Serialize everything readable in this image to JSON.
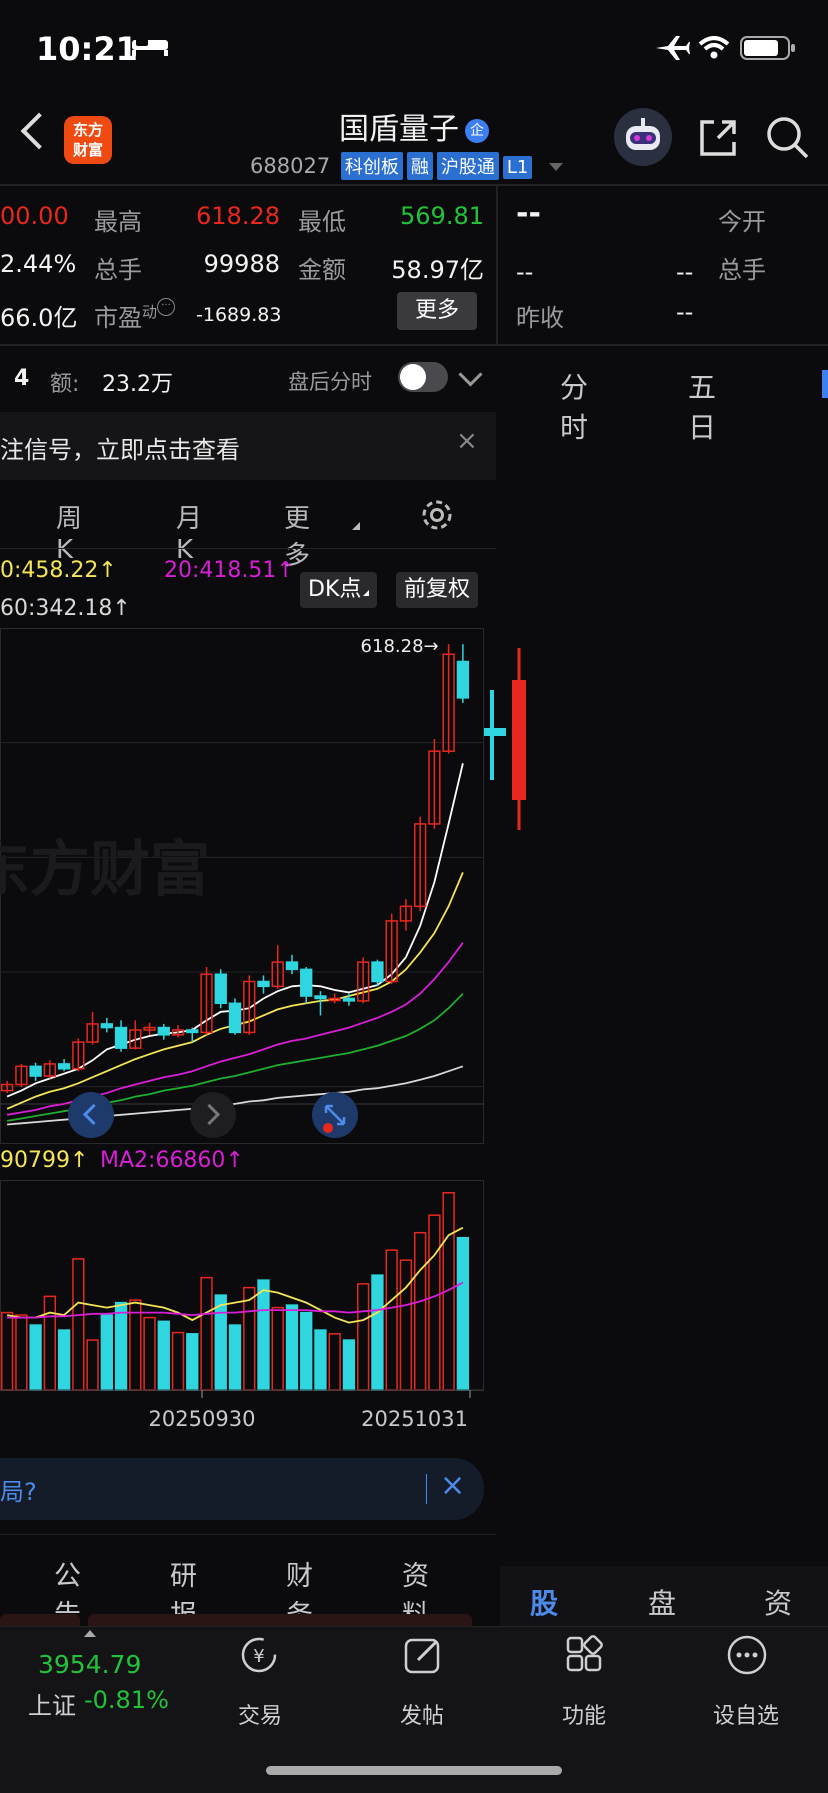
{
  "status_bar": {
    "time": "10:21"
  },
  "header": {
    "logo_text_line1": "东方",
    "logo_text_line2": "财富",
    "stock_name": "国盾量子",
    "name_badge": "企",
    "code": "688027",
    "tags": [
      "科创板",
      "融",
      "沪股通",
      "L1"
    ]
  },
  "quote": {
    "cut_price": "00.00",
    "high_label": "最高",
    "high_value": "618.28",
    "low_label": "最低",
    "low_value": "569.81",
    "cut_pct": "2.44%",
    "volume_label": "总手",
    "volume_value": "99988",
    "amount_label": "金额",
    "amount_value": "58.97亿",
    "cut_cap": "66.0亿",
    "pe_label": "市盈",
    "pe_sup": "动",
    "pe_value": "-1689.83",
    "more_label": "更多"
  },
  "right_quote": {
    "dash_big": "--",
    "open_label": "今开",
    "dash1": "--",
    "dash2": "--",
    "vol_label": "总手",
    "prev_label": "昨收",
    "prev_value": "--"
  },
  "after_hours": {
    "cut_num": "4",
    "amount_label": "额:",
    "amount_value": "23.2万",
    "toggle_label": "盘后分时"
  },
  "right_time_tabs": [
    "分时",
    "五日"
  ],
  "signal_bar": {
    "text": "注信号，立即点击查看"
  },
  "period_tabs": [
    "周K",
    "月K",
    "更多"
  ],
  "ma_legend": {
    "ma10": "0:458.22",
    "ma20": "20:418.51",
    "ma60": "60:342.18"
  },
  "chart_buttons": {
    "dk": "DK点",
    "adjust": "前复权"
  },
  "volume_legend": {
    "ma1": "90799",
    "ma2": "MA2:66860"
  },
  "watermark": "东方财富",
  "chart_data": {
    "type": "candlestick",
    "high_marker": "618.28",
    "x_tick_labels": [
      "20250930",
      "20251031"
    ],
    "candles": [
      {
        "o": 250,
        "c": 255,
        "h": 258,
        "l": 248
      },
      {
        "o": 255,
        "c": 270,
        "h": 272,
        "l": 253
      },
      {
        "o": 270,
        "c": 262,
        "h": 273,
        "l": 258
      },
      {
        "o": 262,
        "c": 272,
        "h": 275,
        "l": 260
      },
      {
        "o": 272,
        "c": 268,
        "h": 276,
        "l": 266
      },
      {
        "o": 268,
        "c": 290,
        "h": 293,
        "l": 266
      },
      {
        "o": 290,
        "c": 305,
        "h": 315,
        "l": 288
      },
      {
        "o": 305,
        "c": 302,
        "h": 310,
        "l": 298
      },
      {
        "o": 302,
        "c": 285,
        "h": 308,
        "l": 282
      },
      {
        "o": 285,
        "c": 300,
        "h": 308,
        "l": 284
      },
      {
        "o": 300,
        "c": 302,
        "h": 306,
        "l": 296
      },
      {
        "o": 302,
        "c": 296,
        "h": 305,
        "l": 292
      },
      {
        "o": 296,
        "c": 300,
        "h": 304,
        "l": 294
      },
      {
        "o": 300,
        "c": 298,
        "h": 302,
        "l": 290
      },
      {
        "o": 298,
        "c": 346,
        "h": 352,
        "l": 296
      },
      {
        "o": 346,
        "c": 322,
        "h": 350,
        "l": 318
      },
      {
        "o": 322,
        "c": 298,
        "h": 326,
        "l": 296
      },
      {
        "o": 298,
        "c": 340,
        "h": 345,
        "l": 296
      },
      {
        "o": 340,
        "c": 336,
        "h": 345,
        "l": 330
      },
      {
        "o": 336,
        "c": 356,
        "h": 370,
        "l": 334
      },
      {
        "o": 356,
        "c": 350,
        "h": 362,
        "l": 346
      },
      {
        "o": 350,
        "c": 328,
        "h": 352,
        "l": 322
      },
      {
        "o": 328,
        "c": 326,
        "h": 332,
        "l": 312
      },
      {
        "o": 326,
        "c": 326,
        "h": 330,
        "l": 322
      },
      {
        "o": 326,
        "c": 324,
        "h": 330,
        "l": 320
      },
      {
        "o": 324,
        "c": 356,
        "h": 360,
        "l": 322
      },
      {
        "o": 356,
        "c": 340,
        "h": 358,
        "l": 336
      },
      {
        "o": 340,
        "c": 390,
        "h": 396,
        "l": 338
      },
      {
        "o": 390,
        "c": 402,
        "h": 408,
        "l": 382
      },
      {
        "o": 402,
        "c": 470,
        "h": 476,
        "l": 398
      },
      {
        "o": 470,
        "c": 530,
        "h": 540,
        "l": 466
      },
      {
        "o": 530,
        "c": 610,
        "h": 618.28,
        "l": 528
      },
      {
        "o": 604,
        "c": 574,
        "h": 618.28,
        "l": 569.81
      }
    ],
    "ma_series": [
      {
        "name": "MA5",
        "values": [
          245,
          250,
          256,
          260,
          264,
          268,
          275,
          284,
          288,
          292,
          295,
          297,
          298,
          300,
          308,
          315,
          316,
          318,
          326,
          332,
          336,
          337,
          336,
          333,
          331,
          334,
          337,
          346,
          360,
          386,
          422,
          470,
          520
        ]
      },
      {
        "name": "MA10",
        "values": [
          235,
          240,
          245,
          249,
          252,
          256,
          261,
          266,
          271,
          276,
          280,
          284,
          287,
          290,
          296,
          301,
          304,
          307,
          312,
          317,
          320,
          322,
          324,
          325,
          328,
          331,
          334,
          340,
          350,
          364,
          380,
          402,
          430
        ]
      },
      {
        "name": "MA20",
        "values": [
          230,
          232,
          234,
          237,
          239,
          242,
          245,
          248,
          252,
          255,
          258,
          261,
          263,
          266,
          270,
          274,
          277,
          280,
          284,
          288,
          291,
          293,
          296,
          299,
          302,
          306,
          310,
          315,
          321,
          330,
          342,
          356,
          372
        ]
      },
      {
        "name": "MA30",
        "values": [
          225,
          227,
          229,
          231,
          233,
          235,
          237,
          240,
          242,
          245,
          247,
          250,
          252,
          254,
          257,
          260,
          262,
          265,
          268,
          271,
          273,
          275,
          277,
          279,
          281,
          284,
          287,
          291,
          295,
          301,
          308,
          318,
          330
        ]
      },
      {
        "name": "MA60",
        "values": [
          222,
          223,
          224,
          225,
          226,
          227,
          228,
          229,
          230,
          231,
          232,
          233,
          234,
          235,
          237,
          238,
          239,
          241,
          242,
          244,
          245,
          246,
          247,
          248,
          249,
          251,
          252,
          254,
          256,
          259,
          262,
          266,
          270
        ]
      }
    ],
    "volume": [
      62000,
      60000,
      52000,
      75000,
      48000,
      105000,
      40000,
      60000,
      70000,
      72000,
      58000,
      55000,
      46000,
      45000,
      90000,
      76000,
      52000,
      82000,
      88000,
      66000,
      68000,
      62000,
      48000,
      45000,
      40000,
      85000,
      92000,
      112000,
      104000,
      126000,
      140000,
      158000,
      122000
    ],
    "volume_ma1": [
      60000,
      58000,
      58000,
      62000,
      60000,
      70000,
      68000,
      66000,
      68000,
      70000,
      68000,
      66000,
      62000,
      56000,
      62000,
      68000,
      70000,
      72000,
      80000,
      78000,
      74000,
      70000,
      64000,
      58000,
      54000,
      56000,
      62000,
      72000,
      82000,
      96000,
      108000,
      124000,
      130000
    ],
    "volume_ma2": [
      58000,
      58000,
      58000,
      59000,
      59000,
      60000,
      61000,
      61000,
      62000,
      62000,
      62000,
      62000,
      61000,
      60000,
      61000,
      62000,
      62000,
      63000,
      64000,
      64000,
      64000,
      64000,
      63000,
      63000,
      62000,
      63000,
      64000,
      66000,
      68000,
      71000,
      75000,
      80000,
      86000
    ]
  },
  "ai_bar": {
    "text": "局?"
  },
  "content_tabs": [
    "公告",
    "研报",
    "财务",
    "资料"
  ],
  "right_bottom_tabs": [
    "股吧",
    "盘口",
    "资讯"
  ],
  "bottom_nav": {
    "index_value": "3954.79",
    "index_name": "上证",
    "index_pct": "-0.81%",
    "items": [
      "交易",
      "发帖",
      "功能",
      "设自选"
    ]
  },
  "colors": {
    "up": "#e8281e",
    "down": "#2fd6e0",
    "ma5": "#ffffff",
    "ma10": "#f3e557",
    "ma20": "#d81fd6",
    "ma30": "#1fae2e",
    "ma60": "#d8d8d8",
    "accent": "#3d7ef0"
  }
}
